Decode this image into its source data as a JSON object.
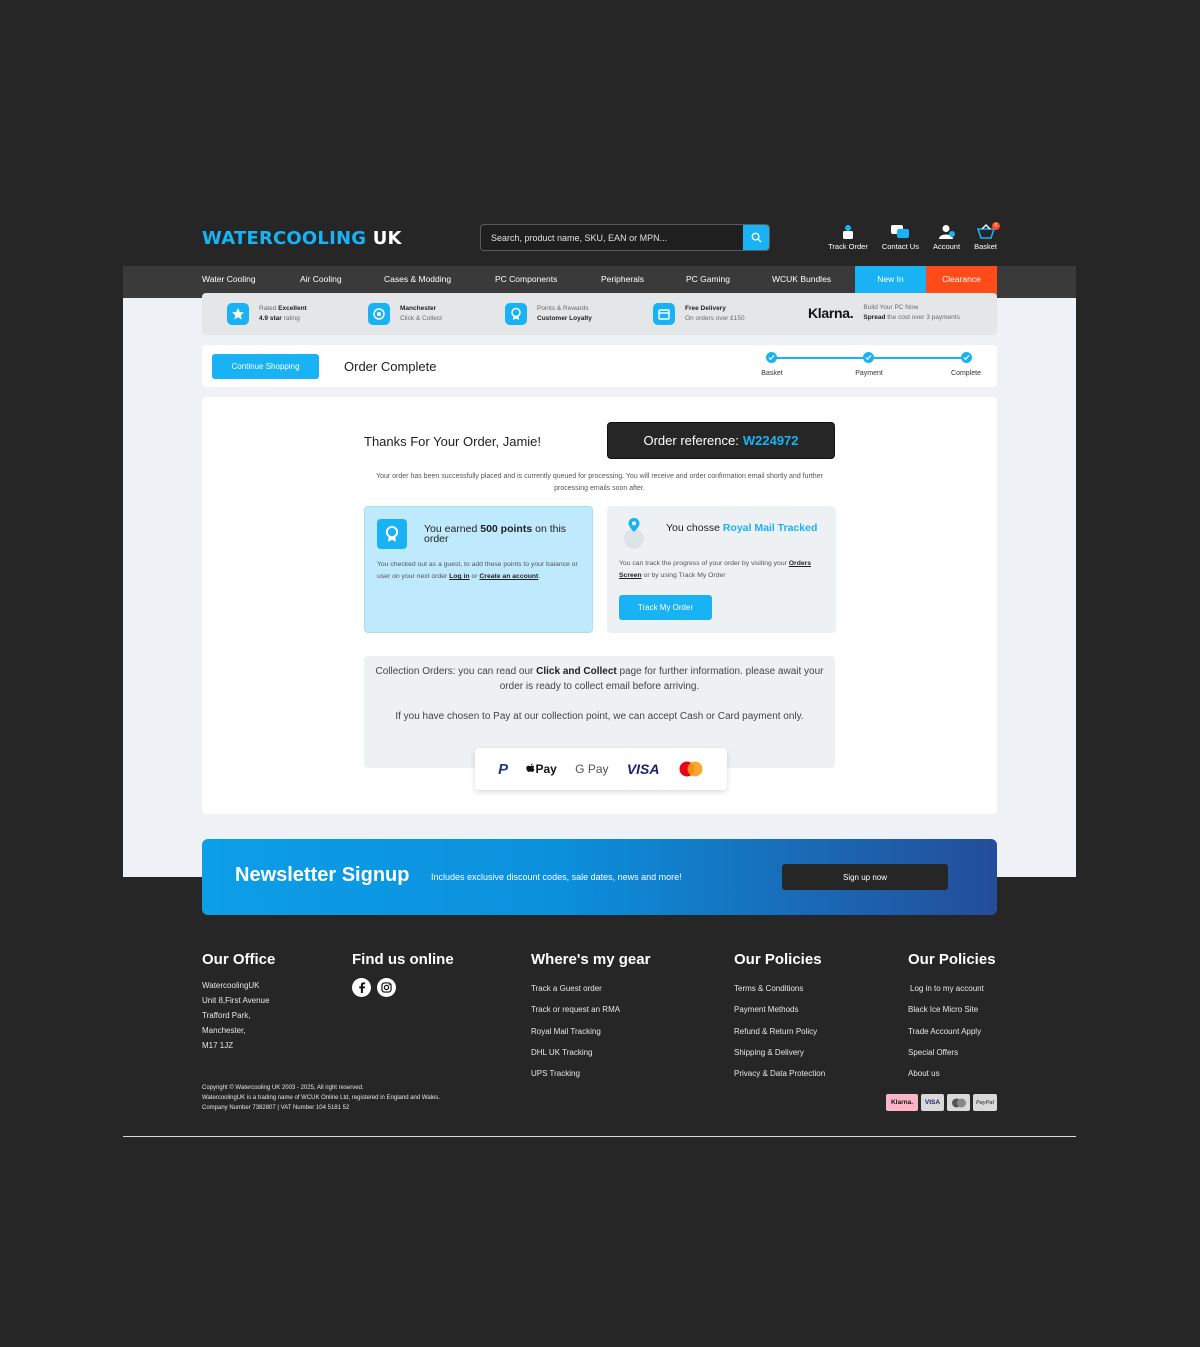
{
  "brand": {
    "part1": "WATERCOOLING",
    "part2": "UK"
  },
  "search": {
    "placeholder": "Search, product name, SKU, EAN or MPN..."
  },
  "header_icons": [
    {
      "label": "Track Order",
      "icon": "track-order-icon"
    },
    {
      "label": "Contact Us",
      "icon": "chat-icon"
    },
    {
      "label": "Account",
      "icon": "account-icon"
    },
    {
      "label": "Basket",
      "icon": "basket-icon",
      "count": "0"
    }
  ],
  "nav": [
    "Water Cooling",
    "Air Cooling",
    "Cases & Modding",
    "PC Components",
    "Peripherals",
    "PC Gaming",
    "WCUK Bundles",
    "New In",
    "Clearance"
  ],
  "usp": {
    "rated": {
      "l1a": "Rated ",
      "l1b": "Excellent",
      "l2a": "4.9 star",
      "l2b": " rating"
    },
    "collect": {
      "l1": "Manchester",
      "l2": "Click & Collect"
    },
    "loyalty": {
      "l1": "Points & Rewards",
      "l2": "Customer Loyalty"
    },
    "delivery": {
      "l1": "Free Delivery",
      "l2": "On orders over £150"
    },
    "klarna": {
      "logo": "Klarna.",
      "l1": "Build Your PC Now",
      "l2a": "Spread",
      "l2b": " the cost over 3 payments"
    }
  },
  "steps": {
    "continue": "Continue Shopping",
    "title": "Order Complete",
    "labels": [
      "Basket",
      "Payment",
      "Complete"
    ]
  },
  "order": {
    "thanks": "Thanks For Your Order, Jamie!",
    "ref_label": "Order reference:",
    "ref_number": "W224972",
    "info": "Your order has been successfully placed and is currently queued for processing. You will receive and order confirmation email shortly and further processing emails soon after."
  },
  "points_box": {
    "t1": "You earned ",
    "points": "500 points",
    "t2": " on this order",
    "body1": "You checked out as a guest, to add these points to your balance or user on your next order ",
    "login": "Log in",
    "or": " or ",
    "create": "Create an account",
    "end": "."
  },
  "ship_box": {
    "t1": "You chosse ",
    "method": "Royal Mail Tracked",
    "body1": "You can track the progress of your order by visiting your ",
    "orders_link": "Orders Screen",
    "body2": " or by using Track My Order",
    "button": "Track My Order"
  },
  "collection": {
    "p1a": "Collection Orders: you can read our ",
    "p1b": "Click and Collect",
    "p1c": " page for further information. please await your order is ready to collect email before arriving.",
    "p2": "If you have chosen to Pay at our collection point, we can accept Cash or Card payment only."
  },
  "pay_methods": [
    "P",
    "Pay",
    "G Pay",
    "VISA"
  ],
  "newsletter": {
    "title": "Newsletter Signup",
    "sub": "Includes exclusive discount codes, sale dates, news and more!",
    "button": "Sign up now"
  },
  "footer": {
    "office": {
      "title": "Our Office",
      "lines": [
        "WatercoolingUK",
        "Unit 8,First Avenue",
        "Trafford Park,",
        "Manchester,",
        "M17 1JZ"
      ]
    },
    "online": {
      "title": "Find us online"
    },
    "gear": {
      "title": "Where's my gear",
      "links": [
        "Track a Guest order",
        "Track or request an RMA",
        "Royal Mail Tracking",
        "DHL UK Tracking",
        "UPS Tracking"
      ]
    },
    "policies": {
      "title": "Our Policies",
      "links": [
        "Terms & Conditions",
        "Payment Methods",
        "Refund & Return Policy",
        "Shipping & Delivery",
        "Privacy & Data Protection"
      ]
    },
    "policies2": {
      "title": "Our Policies",
      "links": [
        "Log in to my account",
        "Black Ice Micro Site",
        "Trade Account Apply",
        "Special Offers",
        "About us"
      ]
    },
    "copyright": [
      "Copyright © Watercooling UK 2003 - 2025, All right reserved.",
      "WatercoolingUK is a trading name of WCUK Online Ltd, registered in England and Wales.",
      "Company Number 7382807 | VAT Number 104 5181 52"
    ],
    "pay": [
      "Klarna.",
      "VISA",
      "PayPal"
    ]
  },
  "colors": {
    "accent": "#19b2f5",
    "dark": "#262626",
    "clearance": "#ff4b1a"
  }
}
